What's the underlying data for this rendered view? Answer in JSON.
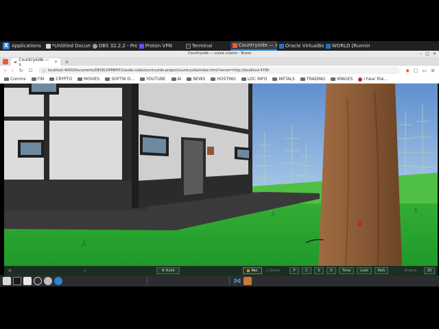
{
  "panel": {
    "apps_label": "Applications",
    "tasks": [
      {
        "label": "*Untitled Docum...",
        "color": "#d8d8d8"
      },
      {
        "label": "OBS 32.2.2 - Pro...",
        "color": "#9aa0a6"
      },
      {
        "label": "Proton VPN",
        "color": "#6d4aff"
      },
      {
        "label": "Terminal",
        "color": "#333333"
      },
      {
        "label": "Countryside — s...",
        "color": "#f05a28"
      },
      {
        "label": "Oracle VirtualBo...",
        "color": "#2a6fb8"
      },
      {
        "label": "WORLD [Runnin...",
        "color": "#2a6fb8"
      }
    ]
  },
  "window": {
    "title": "Countryside — scene creator - Brave"
  },
  "browser": {
    "tab_title": "Countryside — s",
    "new_tab": "+",
    "url": "localhost:4000/Documents/DEVELOPMENT/claude.code/countryside-project/countryside/index.html?server=http://localhost:4790",
    "bookmarks": [
      "Comms",
      "FIN",
      "CRYPTO",
      "MOVIES",
      "SOFTW D...",
      "YOUTUBE",
      "AI",
      "NEWS",
      "HOSTING",
      "LOC INFO",
      "METALS",
      "TRADING",
      "IMAGES"
    ],
    "bookmark_link": "I hear the..."
  },
  "toolbar": {
    "build": "Build",
    "rec": "Rec",
    "scene_label": "Scene",
    "letters": [
      "P",
      "C",
      "S",
      "D"
    ],
    "time": "Time",
    "look": "Look",
    "path": "Path",
    "engine_label": "Engine",
    "mode": "3D"
  },
  "colors": {
    "accent": "#2a83d4",
    "rec": "#f08a00",
    "toolbar_bg": "#1c2d22"
  }
}
